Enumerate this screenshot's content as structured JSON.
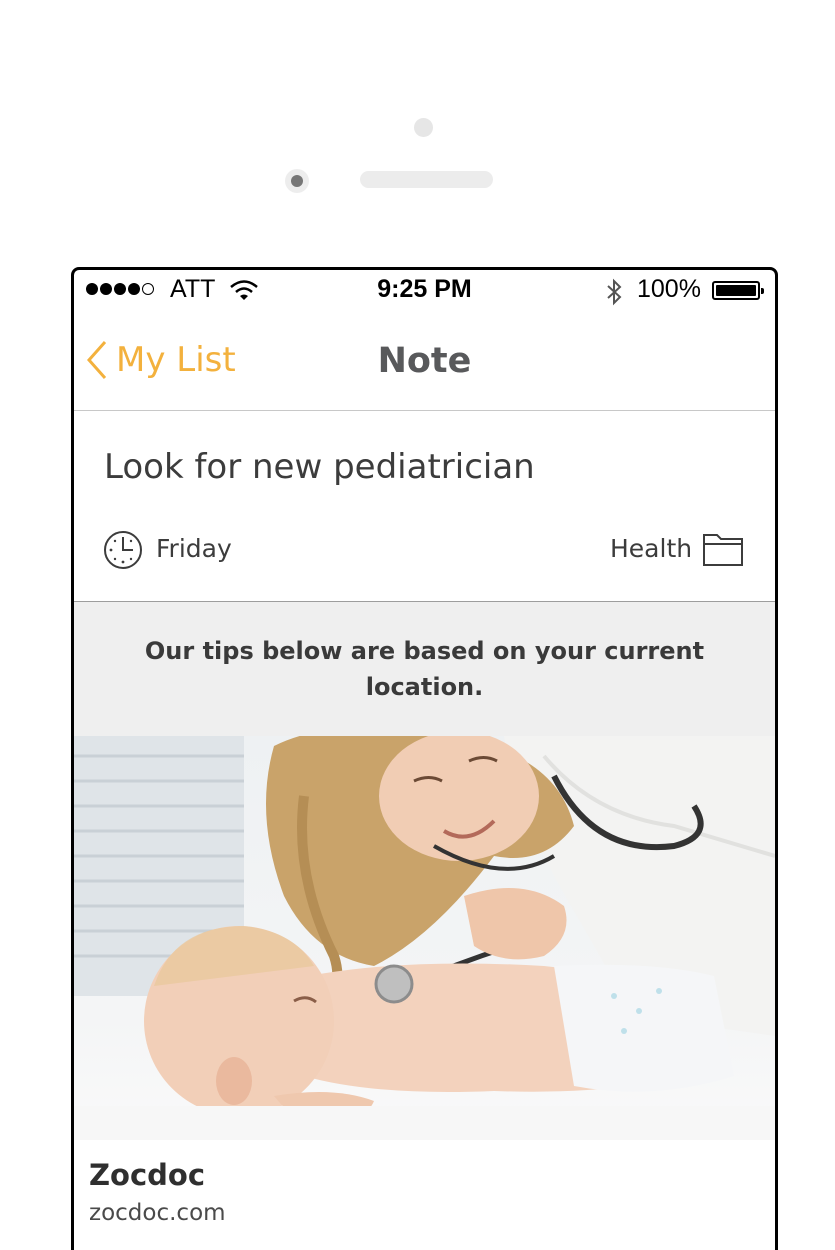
{
  "status_bar": {
    "carrier": "ATT",
    "time": "9:25 PM",
    "battery": "100%",
    "icons": [
      "signal-dots",
      "wifi-icon",
      "bluetooth-icon",
      "battery-icon"
    ]
  },
  "nav": {
    "back_label": "My List",
    "title": "Note"
  },
  "note": {
    "title": "Look for new pediatrician",
    "due": "Friday",
    "category": "Health",
    "icons": [
      "clock-icon",
      "folder-icon"
    ]
  },
  "tips": {
    "text": "Our tips below are based on your current location."
  },
  "card": {
    "image": "doctor-examining-baby-photo",
    "title": "Zocdoc",
    "url": "zocdoc.com"
  },
  "colors": {
    "accent": "#f3b13d",
    "nav_title": "#58595b",
    "tips_bg": "#efefef"
  }
}
